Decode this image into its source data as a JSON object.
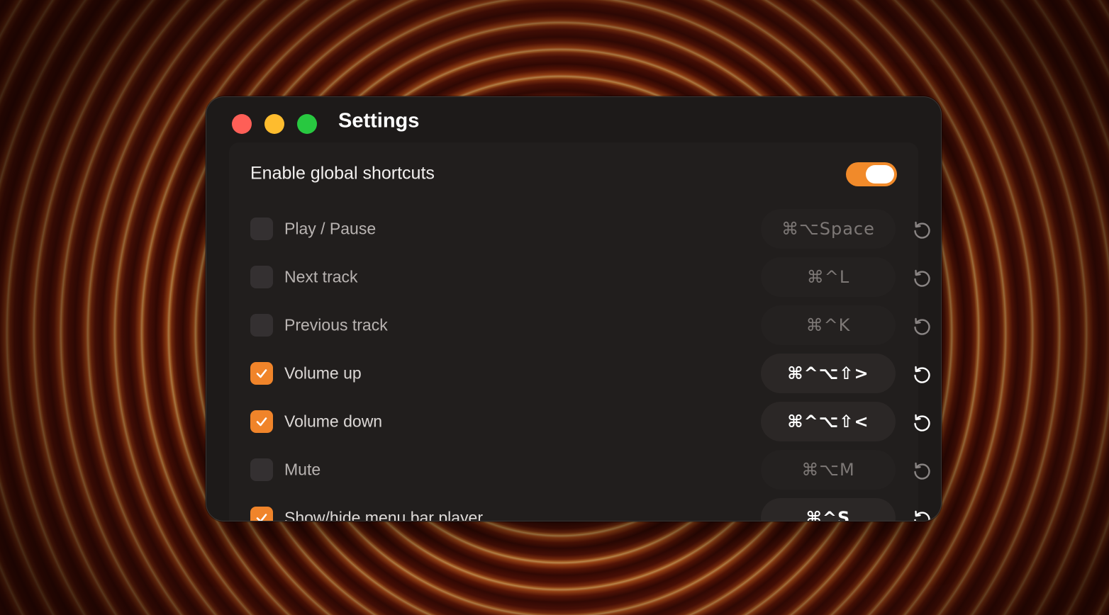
{
  "window": {
    "title": "Settings"
  },
  "global": {
    "label": "Enable global shortcuts",
    "enabled": true
  },
  "shortcuts": [
    {
      "label": "Play / Pause",
      "keys": "⌘⌥Space",
      "checked": false
    },
    {
      "label": "Next track",
      "keys": "⌘^L",
      "checked": false
    },
    {
      "label": "Previous track",
      "keys": "⌘^K",
      "checked": false
    },
    {
      "label": "Volume up",
      "keys": "⌘^⌥⇧>",
      "checked": true
    },
    {
      "label": "Volume down",
      "keys": "⌘^⌥⇧<",
      "checked": true
    },
    {
      "label": "Mute",
      "keys": "⌘⌥M",
      "checked": false
    },
    {
      "label": "Show/hide menu bar player",
      "keys": "⌘^S",
      "checked": true
    }
  ],
  "colors": {
    "accent": "#f0842a",
    "window_bg": "#1d1a19",
    "close": "#fe5f57",
    "minimize": "#febc2e",
    "maximize": "#28c840"
  },
  "icons": {
    "reset": "reset-icon",
    "check": "checkmark-icon"
  }
}
